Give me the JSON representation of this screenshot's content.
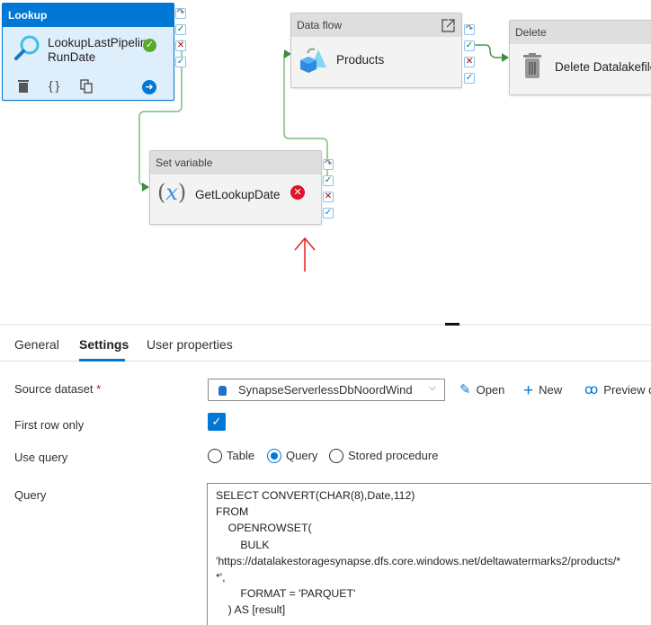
{
  "canvas": {
    "activities": {
      "lookup": {
        "type_label": "Lookup",
        "name_line1": "LookupLastPipeline",
        "name_line2": "RunDate",
        "status": "succeeded",
        "actions": [
          "delete-icon",
          "code-icon",
          "copy-icon",
          "go-icon"
        ]
      },
      "dataflow": {
        "type_label": "Data flow",
        "name": "Products",
        "icon": "dataflow-icon"
      },
      "setvar": {
        "type_label": "Set variable",
        "name": "GetLookupDate",
        "icon_text": "(x)",
        "status": "failed"
      },
      "delete": {
        "type_label": "Delete",
        "name": "Delete Datalakefiles",
        "icon": "trash-icon"
      }
    },
    "ports": {
      "skip": "↷",
      "success": "✓",
      "failure": "✕",
      "completion": "✓"
    },
    "status_glyphs": {
      "ok": "✓",
      "error": "✕"
    },
    "annotation": "red-arrow-up"
  },
  "panel": {
    "tabs": [
      {
        "label": "General",
        "active": false
      },
      {
        "label": "Settings",
        "active": true
      },
      {
        "label": "User properties",
        "active": false
      }
    ],
    "source_dataset": {
      "label": "Source dataset",
      "required_mark": "*",
      "value": "SynapseServerlessDbNoordWind",
      "chevron": "⌵"
    },
    "actions": {
      "open": {
        "icon": "✎",
        "label": "Open"
      },
      "new": {
        "icon": "+",
        "label": "New"
      },
      "preview": {
        "icon": "ꝏ",
        "label": "Preview data"
      }
    },
    "first_row_only": {
      "label": "First row only",
      "checked": true,
      "glyph": "✓"
    },
    "use_query": {
      "label": "Use query",
      "options": [
        "Table",
        "Query",
        "Stored procedure"
      ],
      "selected": "Query"
    },
    "query": {
      "label": "Query",
      "text": "SELECT CONVERT(CHAR(8),Date,112)\nFROM\n    OPENROWSET(\n        BULK\n'https://datalakestoragesynapse.dfs.core.windows.net/deltawatermarks2/products/*\n*',\n        FORMAT = 'PARQUET'\n    ) AS [result]"
    }
  }
}
